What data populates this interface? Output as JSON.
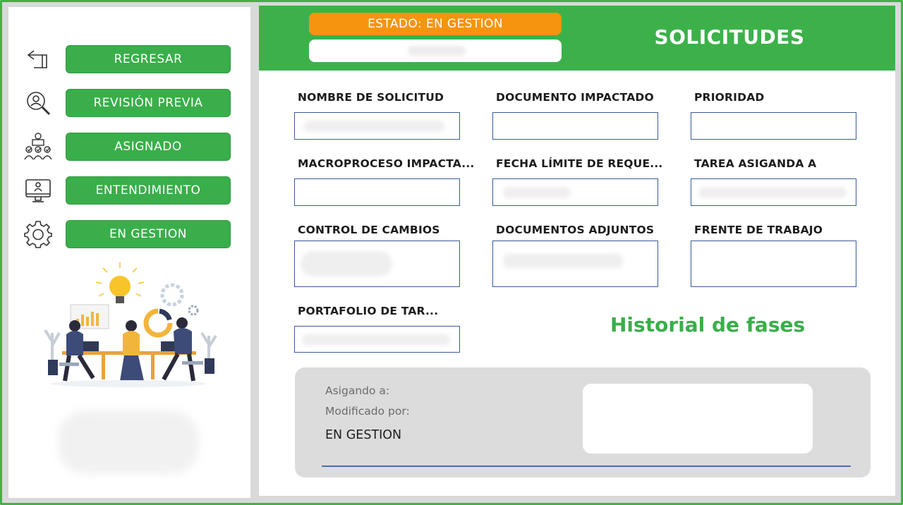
{
  "sidebar": {
    "items": [
      {
        "label": "REGRESAR",
        "icon": "return-arrow-icon"
      },
      {
        "label": "REVISIÓN PREVIA",
        "icon": "magnifier-person-icon"
      },
      {
        "label": "ASIGNADO",
        "icon": "team-assigned-icon"
      },
      {
        "label": "ENTENDIMIENTO",
        "icon": "monitor-user-icon"
      },
      {
        "label": "EN GESTION",
        "icon": "gear-icon"
      }
    ]
  },
  "header": {
    "status": "ESTADO: EN GESTION",
    "title": "SOLICITUDES"
  },
  "fields": [
    {
      "label": "NOMBRE DE SOLICITUD",
      "value": ""
    },
    {
      "label": "DOCUMENTO IMPACTADO",
      "value": ""
    },
    {
      "label": "PRIORIDAD",
      "value": ""
    },
    {
      "label": "MACROPROCESO IMPACTA...",
      "value": ""
    },
    {
      "label": "FECHA LÍMITE DE REQUE...",
      "value": ""
    },
    {
      "label": "TAREA ASIGANDA A",
      "value": ""
    },
    {
      "label": "CONTROL DE CAMBIOS",
      "value": ""
    },
    {
      "label": "DOCUMENTOS ADJUNTOS",
      "value": ""
    },
    {
      "label": "FRENTE DE TRABAJO",
      "value": ""
    },
    {
      "label": "PORTAFOLIO DE TAR...",
      "value": ""
    }
  ],
  "history": {
    "title": "Historial de fases",
    "assigned_label": "Asigando a:",
    "modified_label": "Modificado por:",
    "status": "EN GESTION"
  },
  "colors": {
    "green": "#3cb14a",
    "orange": "#f7940f",
    "field_border": "#3a5a9a"
  }
}
